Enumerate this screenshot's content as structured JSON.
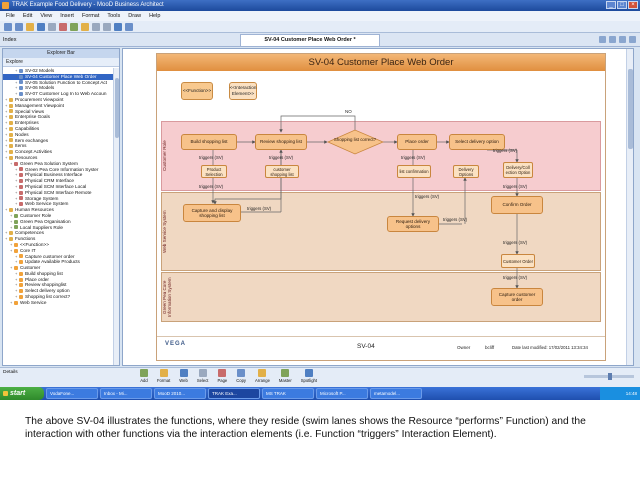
{
  "window": {
    "title": "TRAK Example Food Delivery - MooD Business Architect"
  },
  "menu": [
    "File",
    "Edit",
    "View",
    "Insert",
    "Format",
    "Tools",
    "Draw",
    "Help"
  ],
  "index_tab": "Index",
  "document_tab": "SV-04 Customer Place Web Order *",
  "explorer": {
    "header": "Explorer Bar",
    "label": "Explore",
    "tree": [
      {
        "label": "SV-02 Models",
        "indent": 2,
        "icon": "#6a8fc9"
      },
      {
        "label": "SV-04 Customer Place Web Order",
        "indent": 2,
        "icon": "#6a8fc9",
        "selected": true
      },
      {
        "label": "SV-05 Solution Function to Concept Act",
        "indent": 2,
        "icon": "#6a8fc9"
      },
      {
        "label": "SV-06 Models",
        "indent": 2,
        "icon": "#6a8fc9"
      },
      {
        "label": "SV-07 Customer Log In to Web Accoun",
        "indent": 2,
        "icon": "#6a8fc9"
      },
      {
        "label": "Procurement Viewpoint",
        "indent": 0,
        "icon": "#e2b048"
      },
      {
        "label": "Management Viewpoint",
        "indent": 0,
        "icon": "#e2b048"
      },
      {
        "label": "Special Views",
        "indent": 0,
        "icon": "#e2b048"
      },
      {
        "label": "Enterprise Goals",
        "indent": 0,
        "icon": "#e2b048"
      },
      {
        "label": "Enterprises",
        "indent": 0,
        "icon": "#e2b048"
      },
      {
        "label": "Capabilities",
        "indent": 0,
        "icon": "#e2b048"
      },
      {
        "label": "Nodes",
        "indent": 0,
        "icon": "#e2b048"
      },
      {
        "label": "Item exchanges",
        "indent": 0,
        "icon": "#e2b048"
      },
      {
        "label": "Items",
        "indent": 0,
        "icon": "#e2b048"
      },
      {
        "label": "Concept Activities",
        "indent": 0,
        "icon": "#e2b048"
      },
      {
        "label": "Resources",
        "indent": 0,
        "icon": "#e2b048"
      },
      {
        "label": "Green Pea Solution System",
        "indent": 1,
        "icon": "#c86b6b"
      },
      {
        "label": "Green Pea Core Information Syster",
        "indent": 2,
        "icon": "#c86b6b"
      },
      {
        "label": "Physical Business Interface",
        "indent": 2,
        "icon": "#c86b6b"
      },
      {
        "label": "Physical CRM Interface",
        "indent": 2,
        "icon": "#c86b6b"
      },
      {
        "label": "Physical SCM Interface Local",
        "indent": 2,
        "icon": "#c86b6b"
      },
      {
        "label": "Physical SCM Interface Remote",
        "indent": 2,
        "icon": "#c86b6b"
      },
      {
        "label": "Storage System",
        "indent": 2,
        "icon": "#c86b6b"
      },
      {
        "label": "Web Service System",
        "indent": 2,
        "icon": "#c86b6b"
      },
      {
        "label": "Human Resources",
        "indent": 0,
        "icon": "#e2b048"
      },
      {
        "label": "Customer Role",
        "indent": 1,
        "icon": "#7fa35a"
      },
      {
        "label": "Green Pea Organisation",
        "indent": 1,
        "icon": "#7fa35a"
      },
      {
        "label": "Local Suppliers Role",
        "indent": 1,
        "icon": "#7fa35a"
      },
      {
        "label": "Competences",
        "indent": 0,
        "icon": "#e2b048"
      },
      {
        "label": "Functions",
        "indent": 0,
        "icon": "#e2b048"
      },
      {
        "label": "<<Function>>",
        "indent": 1,
        "icon": "#f1a23a"
      },
      {
        "label": "Core IT",
        "indent": 1,
        "icon": "#f1a23a"
      },
      {
        "label": "Capture customer order",
        "indent": 2,
        "icon": "#f1a23a"
      },
      {
        "label": "Update Available Products",
        "indent": 2,
        "icon": "#f1a23a"
      },
      {
        "label": "Customer",
        "indent": 1,
        "icon": "#f1a23a"
      },
      {
        "label": "Build shopping list",
        "indent": 2,
        "icon": "#f1a23a"
      },
      {
        "label": "Place order",
        "indent": 2,
        "icon": "#f1a23a"
      },
      {
        "label": "Review shoppinglist",
        "indent": 2,
        "icon": "#f1a23a"
      },
      {
        "label": "Select delivery option",
        "indent": 2,
        "icon": "#f1a23a"
      },
      {
        "label": "Shopping list correct?",
        "indent": 2,
        "icon": "#f1a23a"
      },
      {
        "label": "Web Service",
        "indent": 1,
        "icon": "#f1a23a"
      }
    ]
  },
  "diagram": {
    "title": "SV-04 Customer Place Web Order",
    "legend_function": "<<Function>>",
    "legend_interaction": "<<Interaction Element>>",
    "lanes": {
      "customer": "Customer Role",
      "web": "Web Service System",
      "core": "Green Pea Core Information System"
    },
    "functions": {
      "build": "Build shopping list",
      "review": "Review shopping list",
      "decision": "Shopping list correct?",
      "place": "Place order",
      "select": "Select delivery option",
      "capture_display": "Capture and display shopping list",
      "request_delivery": "Request delivery options",
      "confirm_order": "Confirm Order",
      "capture_customer": "Capture customer order"
    },
    "interactions": {
      "product_selection": "Product Selection",
      "customer_shopping": "customer shopping list",
      "list_confirmation": "list confirmation",
      "delivery_options": "Delivery Options",
      "delivery_collection": "Delivery/Coll ection Option",
      "customer_order": "Customer Order"
    },
    "trigger_label": "triggers (SV)",
    "no_label": "NO",
    "footer": {
      "brand": "VEGA",
      "id": "SV-04",
      "owner_label": "Owner",
      "owner_value": "bcliff",
      "date_label": "Date last modified: 17/02/2011 13:34:34"
    }
  },
  "details_label": "Details",
  "bottom_tools": [
    "Add",
    "Format",
    "Web",
    "Select",
    "Page",
    "Copy",
    "Arrange",
    "Master",
    "Spotlight"
  ],
  "taskbar": {
    "start": "start",
    "tasks": [
      "VodaFone...",
      "Inbox - Mi...",
      "MooD 2010...",
      "TRAK Exa...",
      "MS TRAK",
      "Microsoft P...",
      "metamodel..."
    ],
    "time": "14:48"
  },
  "caption": "The above SV-04 illustrates the functions, where they reside (swim lanes shows the Resource “performs” Function) and the interaction with other functions via the interaction elements (i.e. Function “triggers” Interaction Element)."
}
